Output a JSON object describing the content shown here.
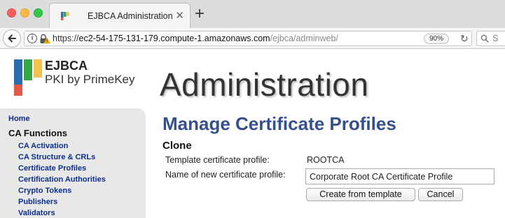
{
  "browser": {
    "tab": {
      "title": "EJBCA Administration"
    },
    "address": {
      "scheme": "https://",
      "host": "ec2-54-175-131-179.compute-1.amazonaws.com",
      "path": "/ejbca/adminweb/"
    },
    "zoom": "90%",
    "search": {
      "placeholder": "S"
    }
  },
  "branding": {
    "name": "EJBCA",
    "tagline": "PKI by PrimeKey",
    "colors": {
      "blue": "#2b6cb0",
      "green": "#3aa64a",
      "yellow": "#f2c14e",
      "red": "#e05a47"
    }
  },
  "header": {
    "title": "Administration"
  },
  "sidebar": {
    "home": "Home",
    "section": "CA Functions",
    "items": [
      "CA Activation",
      "CA Structure & CRLs",
      "Certificate Profiles",
      "Certification Authorities",
      "Crypto Tokens",
      "Publishers",
      "Validators"
    ]
  },
  "main": {
    "heading": "Manage Certificate Profiles",
    "section": "Clone",
    "template_label": "Template certificate profile:",
    "template_value": "ROOTCA",
    "name_label": "Name of new certificate profile:",
    "name_value": "Corporate Root CA Certificate Profile",
    "create_button": "Create from template",
    "cancel_button": "Cancel"
  }
}
